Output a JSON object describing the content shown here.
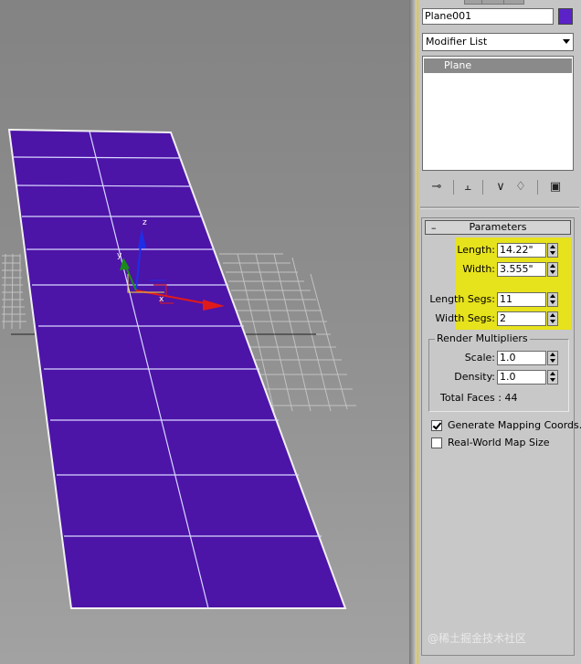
{
  "viewport": {
    "axis_labels": {
      "z": "z",
      "y": "y",
      "x": "x"
    },
    "colors": {
      "plane": "#4d14a8",
      "plane_lines": "#d8d8ff",
      "grid": "#c0c0c0",
      "background": "#8e8e8e"
    }
  },
  "command_panel": {
    "object_name": "Plane001",
    "object_color": "#5b22c8",
    "modifier_list": {
      "selected": "Modifier List"
    },
    "modifier_stack": [
      "Plane"
    ],
    "stack_tools": [
      "pin-stack-icon",
      "show-end-result-icon",
      "make-unique-icon",
      "remove-modifier-icon",
      "configure-sets-icon"
    ],
    "parameters": {
      "title": "Parameters",
      "length_label": "Length:",
      "length_value": "14.22\"",
      "width_label": "Width:",
      "width_value": "3.555\"",
      "length_segs_label": "Length Segs:",
      "length_segs_value": "11",
      "width_segs_label": "Width Segs:",
      "width_segs_value": "2",
      "highlight_color": "#e6e21c"
    },
    "render_multipliers": {
      "title": "Render Multipliers",
      "scale_label": "Scale:",
      "scale_value": "1.0",
      "density_label": "Density:",
      "density_value": "1.0",
      "total_faces": "Total Faces : 44"
    },
    "options": {
      "generate_mapping": {
        "label": "Generate Mapping Coords.",
        "checked": true
      },
      "real_world_map": {
        "label": "Real-World Map Size",
        "checked": false
      }
    }
  },
  "watermark": "@稀土掘金技术社区"
}
